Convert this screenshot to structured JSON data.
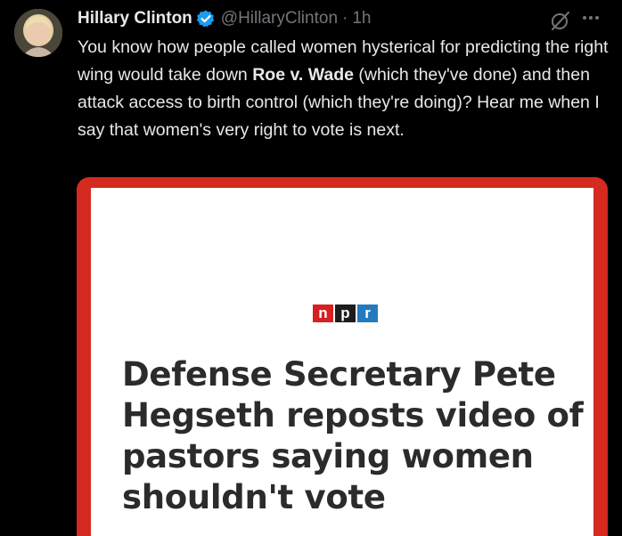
{
  "tweet": {
    "author_name": "Hillary Clinton",
    "handle": "@HillaryClinton",
    "separator": "·",
    "time": "1h",
    "text_part1": "You know how people called women hysterical for predicting the right wing would take down ",
    "text_bold": "Roe v. Wade",
    "text_part2": " (which they've done) and then attack access to birth control (which they're doing)? Hear me when I say that women's very right to vote is next."
  },
  "icons": {
    "verified": "verified-badge-icon",
    "grok": "grok-icon",
    "more": "more-options-icon"
  },
  "card": {
    "logo": {
      "n": "n",
      "p": "p",
      "r": "r"
    },
    "headline": "Defense Secretary Pete Hegseth reposts video of pastors saying women shouldn't vote"
  },
  "colors": {
    "background": "#000000",
    "primary_text": "#e7e9ea",
    "secondary_text": "#71767b",
    "verified_blue": "#1d9bf0",
    "card_border_red": "#d52a1f",
    "npr_red": "#d62021",
    "npr_black": "#1d1d1d",
    "npr_blue": "#237bbd"
  }
}
